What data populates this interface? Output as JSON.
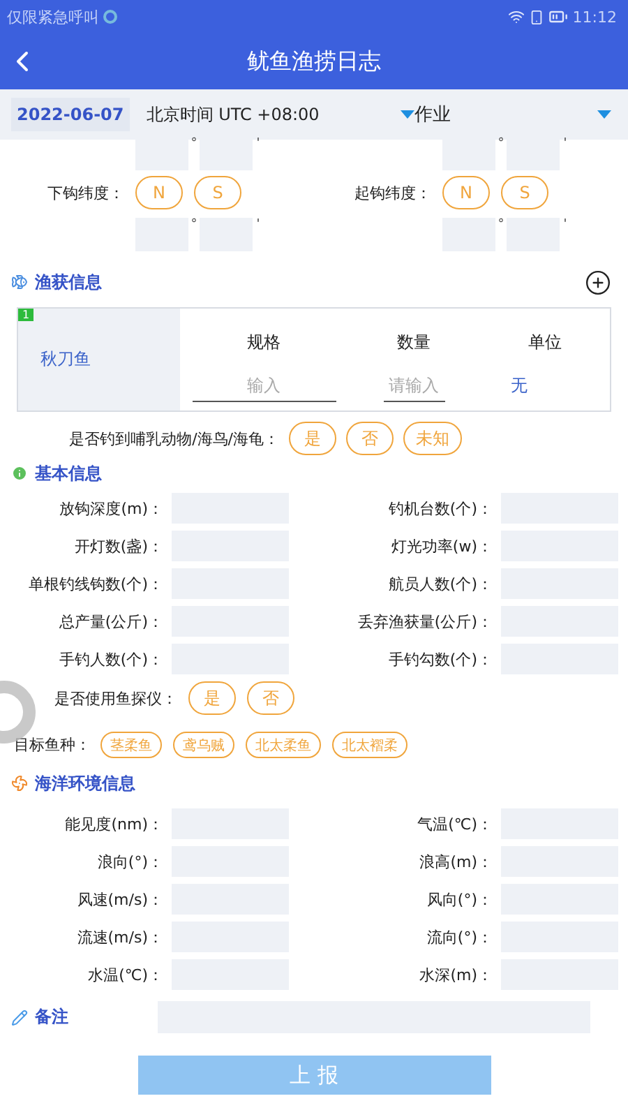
{
  "status_bar": {
    "notice": "仅限紧急呼叫",
    "time": "11:12"
  },
  "header": {
    "title": "鱿鱼渔捞日志"
  },
  "toolbar": {
    "date": "2022-06-07",
    "timezone": "北京时间 UTC +08:00",
    "mode": "作业"
  },
  "position": {
    "degree_mark": "°",
    "minute_mark": "'",
    "latitudes": [
      {
        "label": "下钩纬度：",
        "options": [
          {
            "label": "N",
            "selected": false
          },
          {
            "label": "S",
            "selected": false
          }
        ]
      },
      {
        "label": "起钩纬度：",
        "options": [
          {
            "label": "N",
            "selected": false
          },
          {
            "label": "S",
            "selected": false
          }
        ]
      }
    ]
  },
  "catch": {
    "title": "渔获信息",
    "items": [
      {
        "index": "1",
        "name": "秋刀鱼",
        "columns": [
          "规格",
          "数量",
          "单位"
        ],
        "spec_placeholder": "输入",
        "quantity_placeholder": "请输入",
        "unit": "无"
      }
    ],
    "question": {
      "label": "是否钓到哺乳动物/海鸟/海龟：",
      "options": [
        {
          "label": "是",
          "selected": false
        },
        {
          "label": "否",
          "selected": false
        },
        {
          "label": "未知",
          "selected": false
        }
      ]
    }
  },
  "basic": {
    "title": "基本信息",
    "fields": [
      "放钩深度(m)：",
      "钓机台数(个)：",
      "开灯数(盏)：",
      "灯光功率(w)：",
      "单根钓线钩数(个)：",
      "航员人数(个)：",
      "总产量(公斤)：",
      "丢弃渔获量(公斤)：",
      "手钓人数(个)：",
      "手钓勾数(个)："
    ],
    "finder": {
      "label": "是否使用鱼探仪：",
      "options": [
        {
          "label": "是",
          "selected": false
        },
        {
          "label": "否",
          "selected": false
        }
      ]
    },
    "target": {
      "label": "目标鱼种：",
      "options": [
        {
          "label": "茎柔鱼",
          "selected": false
        },
        {
          "label": "鸢乌贼",
          "selected": false
        },
        {
          "label": "北太柔鱼",
          "selected": false
        },
        {
          "label": "北太褶柔",
          "selected": false
        }
      ]
    }
  },
  "environment": {
    "title": "海洋环境信息",
    "fields": [
      "能见度(nm)：",
      "气温(℃)：",
      "浪向(°)：",
      "浪高(m)：",
      "风速(m/s)：",
      "风向(°)：",
      "流速(m/s)：",
      "流向(°)：",
      "水温(℃)：",
      "水深(m)："
    ]
  },
  "remarks": {
    "title": "备注"
  },
  "submit": {
    "label": "上 报"
  }
}
